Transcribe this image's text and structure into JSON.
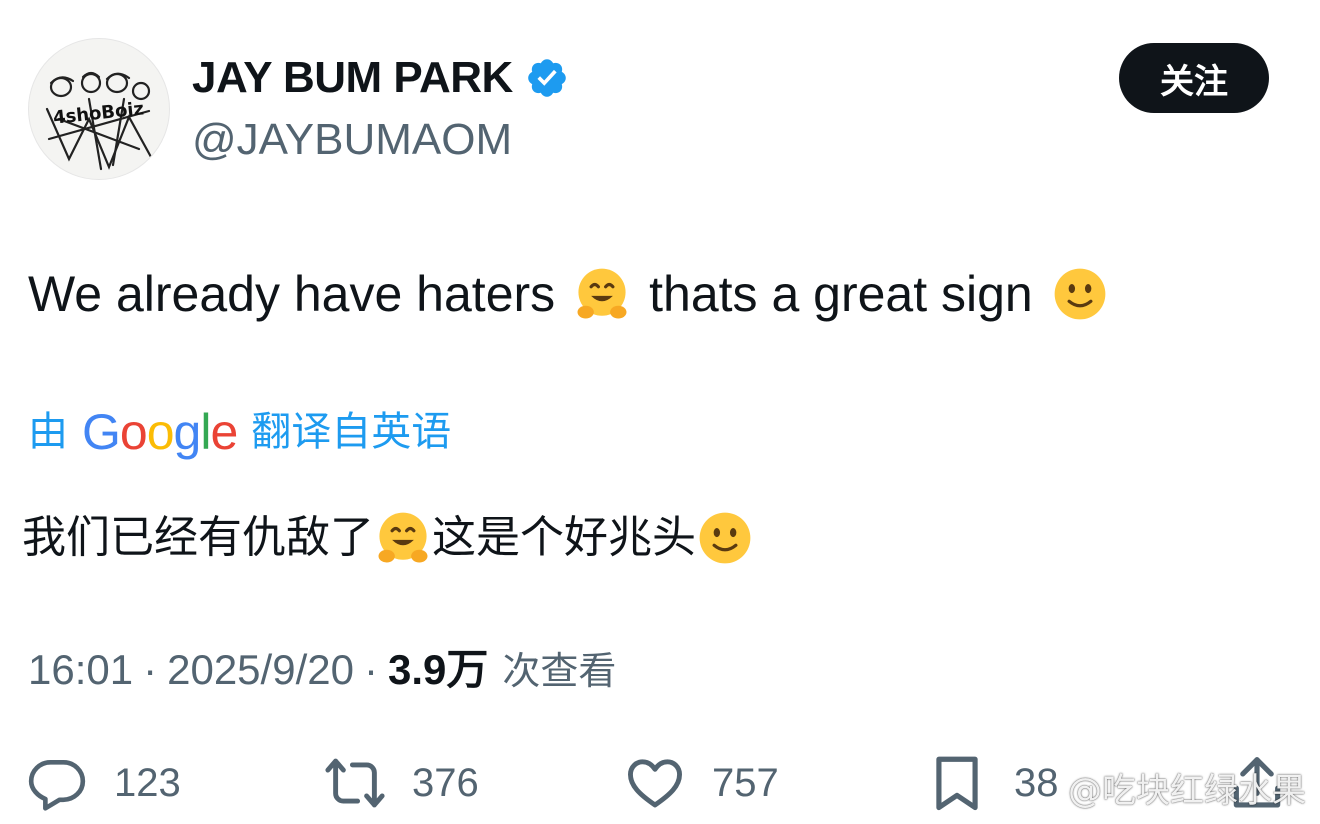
{
  "author": {
    "display_name": "JAY BUM PARK",
    "handle": "@JAYBUMAOM",
    "verified": true,
    "avatar_text": "4shoBoiz"
  },
  "follow_button": {
    "label": "关注"
  },
  "tweet": {
    "text_part1": "We already have haters",
    "emoji1": "hugging-face-emoji",
    "text_part2": "thats a great sign",
    "emoji2": "slightly-smiling-face-emoji"
  },
  "translation": {
    "prefix": "由",
    "provider": "Google",
    "suffix": "翻译自英语",
    "text_part1": "我们已经有仇敌了",
    "text_part2": "这是个好兆头"
  },
  "meta": {
    "time": "16:01",
    "separator": "·",
    "date": "2025/9/20",
    "views": "3.9万",
    "views_label": "次查看"
  },
  "actions": {
    "replies": "123",
    "reposts": "376",
    "likes": "757",
    "bookmarks": "38"
  },
  "watermark": "@吃块红绿水果",
  "colors": {
    "link_blue": "#1d9bf0",
    "muted_gray": "#536471",
    "text_black": "#0f1419",
    "verified_blue": "#1d9bf0"
  }
}
